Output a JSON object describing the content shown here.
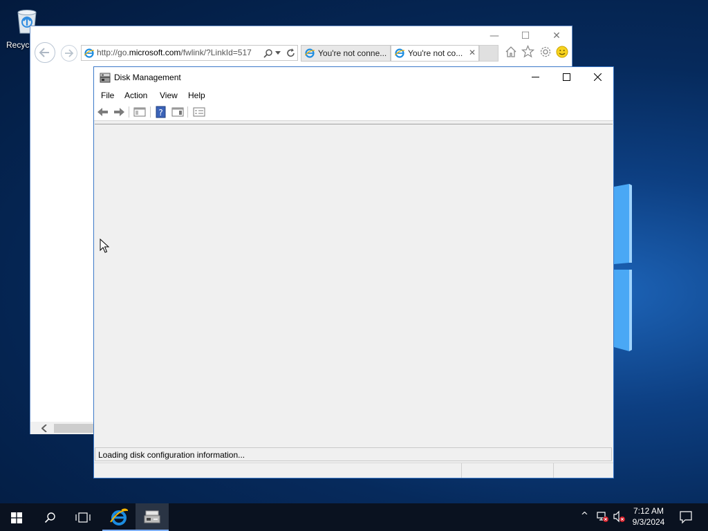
{
  "desktop": {
    "recycle_bin_label": "Recycl"
  },
  "ie_window": {
    "address_prefix": "http://go.",
    "address_host": "microsoft.com",
    "address_rest": "/fwlink/?LinkId=517",
    "tabs": [
      {
        "title": "You're not conne..."
      },
      {
        "title": "You're not co..."
      }
    ],
    "minimize_glyph": "—",
    "maximize_glyph": "☐",
    "close_glyph": "✕",
    "tab_close_glyph": "✕"
  },
  "disk_management": {
    "title": "Disk Management",
    "menu": [
      "File",
      "Action",
      "View",
      "Help"
    ],
    "status_text": "Loading disk configuration information..."
  },
  "taskbar": {
    "time": "7:12 AM",
    "date": "9/3/2024",
    "tray_chevron": "^"
  },
  "colors": {
    "desktop_bg": "#0d3f82",
    "window_border": "#3a78c8",
    "taskbar_bg": "#0a1220",
    "ie_blue": "#1c8ce0"
  }
}
